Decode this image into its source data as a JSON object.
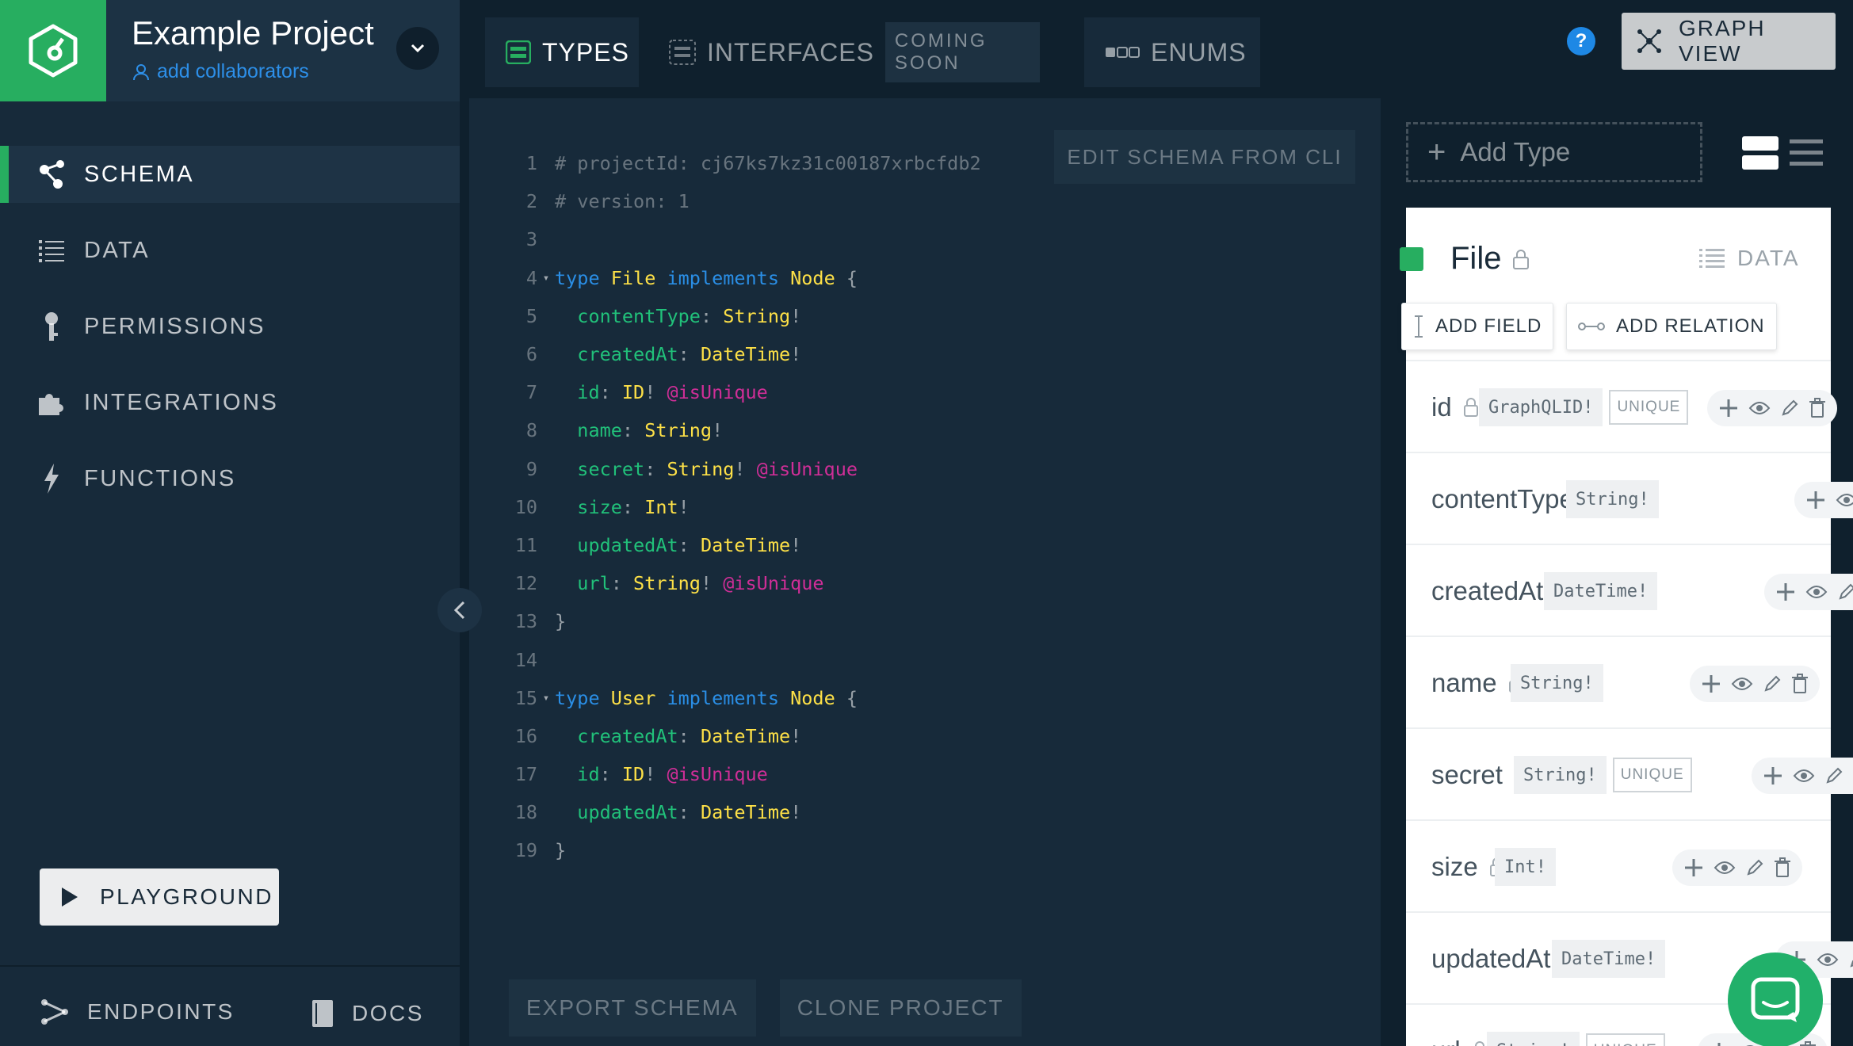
{
  "project": {
    "name": "Example Project",
    "collaborators_link": "add collaborators"
  },
  "sidebar": {
    "items": [
      {
        "label": "SCHEMA",
        "icon": "schema-icon",
        "active": true
      },
      {
        "label": "DATA",
        "icon": "list-icon"
      },
      {
        "label": "PERMISSIONS",
        "icon": "key-icon"
      },
      {
        "label": "INTEGRATIONS",
        "icon": "puzzle-icon"
      },
      {
        "label": "FUNCTIONS",
        "icon": "lightning-icon"
      }
    ],
    "playground_label": "PLAYGROUND",
    "bottom": {
      "endpoints": "ENDPOINTS",
      "docs": "DOCS"
    }
  },
  "tabs": {
    "types": "TYPES",
    "interfaces": "INTERFACES",
    "coming_soon": "COMING SOON",
    "enums": "ENUMS"
  },
  "header": {
    "help": "?",
    "graph_view": "GRAPH VIEW"
  },
  "editor": {
    "edit_from_cli": "EDIT SCHEMA FROM CLI",
    "export_schema": "EXPORT SCHEMA",
    "clone_project": "CLONE PROJECT",
    "lines": [
      {
        "n": "1",
        "fold": false,
        "tokens": [
          [
            "com",
            "# projectId: cj67ks7kz31c00187xrbcfdb2"
          ]
        ]
      },
      {
        "n": "2",
        "fold": false,
        "tokens": [
          [
            "com",
            "# version: 1"
          ]
        ]
      },
      {
        "n": "3",
        "fold": false,
        "tokens": []
      },
      {
        "n": "4",
        "fold": true,
        "tokens": [
          [
            "kw",
            "type"
          ],
          [
            "txt",
            " "
          ],
          [
            "name",
            "File"
          ],
          [
            "txt",
            " "
          ],
          [
            "kw",
            "implements"
          ],
          [
            "txt",
            " "
          ],
          [
            "name",
            "Node"
          ],
          [
            "punc",
            " {"
          ]
        ]
      },
      {
        "n": "5",
        "fold": false,
        "tokens": [
          [
            "txt",
            "  "
          ],
          [
            "field",
            "contentType"
          ],
          [
            "punc",
            ": "
          ],
          [
            "name",
            "String"
          ],
          [
            "punc",
            "!"
          ]
        ]
      },
      {
        "n": "6",
        "fold": false,
        "tokens": [
          [
            "txt",
            "  "
          ],
          [
            "field",
            "createdAt"
          ],
          [
            "punc",
            ": "
          ],
          [
            "name",
            "DateTime"
          ],
          [
            "punc",
            "!"
          ]
        ]
      },
      {
        "n": "7",
        "fold": false,
        "tokens": [
          [
            "txt",
            "  "
          ],
          [
            "field",
            "id"
          ],
          [
            "punc",
            ": "
          ],
          [
            "name",
            "ID"
          ],
          [
            "punc",
            "! "
          ],
          [
            "dir",
            "@isUnique"
          ]
        ]
      },
      {
        "n": "8",
        "fold": false,
        "tokens": [
          [
            "txt",
            "  "
          ],
          [
            "field",
            "name"
          ],
          [
            "punc",
            ": "
          ],
          [
            "name",
            "String"
          ],
          [
            "punc",
            "!"
          ]
        ]
      },
      {
        "n": "9",
        "fold": false,
        "tokens": [
          [
            "txt",
            "  "
          ],
          [
            "field",
            "secret"
          ],
          [
            "punc",
            ": "
          ],
          [
            "name",
            "String"
          ],
          [
            "punc",
            "! "
          ],
          [
            "dir",
            "@isUnique"
          ]
        ]
      },
      {
        "n": "10",
        "fold": false,
        "tokens": [
          [
            "txt",
            "  "
          ],
          [
            "field",
            "size"
          ],
          [
            "punc",
            ": "
          ],
          [
            "name",
            "Int"
          ],
          [
            "punc",
            "!"
          ]
        ]
      },
      {
        "n": "11",
        "fold": false,
        "tokens": [
          [
            "txt",
            "  "
          ],
          [
            "field",
            "updatedAt"
          ],
          [
            "punc",
            ": "
          ],
          [
            "name",
            "DateTime"
          ],
          [
            "punc",
            "!"
          ]
        ]
      },
      {
        "n": "12",
        "fold": false,
        "tokens": [
          [
            "txt",
            "  "
          ],
          [
            "field",
            "url"
          ],
          [
            "punc",
            ": "
          ],
          [
            "name",
            "String"
          ],
          [
            "punc",
            "! "
          ],
          [
            "dir",
            "@isUnique"
          ]
        ]
      },
      {
        "n": "13",
        "fold": false,
        "tokens": [
          [
            "punc",
            "}"
          ]
        ]
      },
      {
        "n": "14",
        "fold": false,
        "tokens": []
      },
      {
        "n": "15",
        "fold": true,
        "tokens": [
          [
            "kw",
            "type"
          ],
          [
            "txt",
            " "
          ],
          [
            "name",
            "User"
          ],
          [
            "txt",
            " "
          ],
          [
            "kw",
            "implements"
          ],
          [
            "txt",
            " "
          ],
          [
            "name",
            "Node"
          ],
          [
            "punc",
            " {"
          ]
        ]
      },
      {
        "n": "16",
        "fold": false,
        "tokens": [
          [
            "txt",
            "  "
          ],
          [
            "field",
            "createdAt"
          ],
          [
            "punc",
            ": "
          ],
          [
            "name",
            "DateTime"
          ],
          [
            "punc",
            "!"
          ]
        ]
      },
      {
        "n": "17",
        "fold": false,
        "tokens": [
          [
            "txt",
            "  "
          ],
          [
            "field",
            "id"
          ],
          [
            "punc",
            ": "
          ],
          [
            "name",
            "ID"
          ],
          [
            "punc",
            "! "
          ],
          [
            "dir",
            "@isUnique"
          ]
        ]
      },
      {
        "n": "18",
        "fold": false,
        "tokens": [
          [
            "txt",
            "  "
          ],
          [
            "field",
            "updatedAt"
          ],
          [
            "punc",
            ": "
          ],
          [
            "name",
            "DateTime"
          ],
          [
            "punc",
            "!"
          ]
        ]
      },
      {
        "n": "19",
        "fold": false,
        "tokens": [
          [
            "punc",
            "}"
          ]
        ]
      }
    ]
  },
  "right_panel": {
    "add_type": "Add Type",
    "type_card": {
      "name": "File",
      "data_label": "DATA",
      "add_field": "ADD FIELD",
      "add_relation": "ADD RELATION",
      "fields": [
        {
          "name": "id",
          "type": "GraphQLID!",
          "unique": "UNIQUE"
        },
        {
          "name": "contentType",
          "type": "String!",
          "unique": ""
        },
        {
          "name": "createdAt",
          "type": "DateTime!",
          "unique": ""
        },
        {
          "name": "name",
          "type": "String!",
          "unique": ""
        },
        {
          "name": "secret",
          "type": "String!",
          "unique": "UNIQUE"
        },
        {
          "name": "size",
          "type": "Int!",
          "unique": ""
        },
        {
          "name": "updatedAt",
          "type": "DateTime!",
          "unique": ""
        },
        {
          "name": "url",
          "type": "String!",
          "unique": "UNIQUE"
        }
      ]
    }
  },
  "colors": {
    "accent_green": "#27ae60",
    "link_blue": "#2d8fe8",
    "keyword": "#2a8ee5",
    "type_name": "#fde047",
    "field": "#21c17a",
    "directive": "#cf2e97"
  }
}
